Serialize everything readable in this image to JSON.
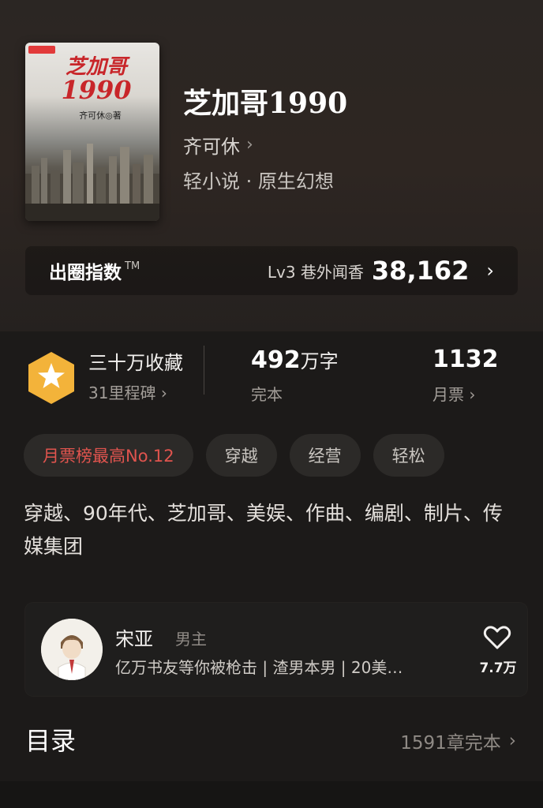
{
  "book": {
    "cover_title": "芝加哥",
    "cover_year": "1990",
    "cover_author": "齐可休◎著",
    "title": "芝加哥1990",
    "author": "齐可休",
    "genre": "轻小说 · 原生幻想"
  },
  "index_bar": {
    "label": "出圈指数",
    "tm": "TM",
    "level": "Lv3 巷外闻香",
    "score": "38,162"
  },
  "stats": {
    "favorites_title": "三十万收藏",
    "milestones": "31里程碑",
    "words_num": "492",
    "words_unit": "万字",
    "words_status": "完本",
    "monthly_votes": "1132",
    "monthly_votes_label": "月票"
  },
  "tags": [
    "月票榜最高No.12",
    "穿越",
    "经营",
    "轻松"
  ],
  "description": "穿越、90年代、芝加哥、美娱、作曲、编剧、制片、传媒集团",
  "role": {
    "name": "宋亚",
    "type": "男主",
    "summary": "亿万书友等你被枪击 | 渣男本男 | 20美…",
    "likes": "7.7万"
  },
  "toc": {
    "label": "目录",
    "meta": "1591章完本"
  },
  "colors": {
    "rank_tag": "#e0544e",
    "medal": "#f3b33a",
    "background": "#1c1a19"
  },
  "icons": {
    "author_chevron": "chevron-right-icon",
    "medal": "star-medal-icon",
    "like": "heart-outline-icon"
  }
}
